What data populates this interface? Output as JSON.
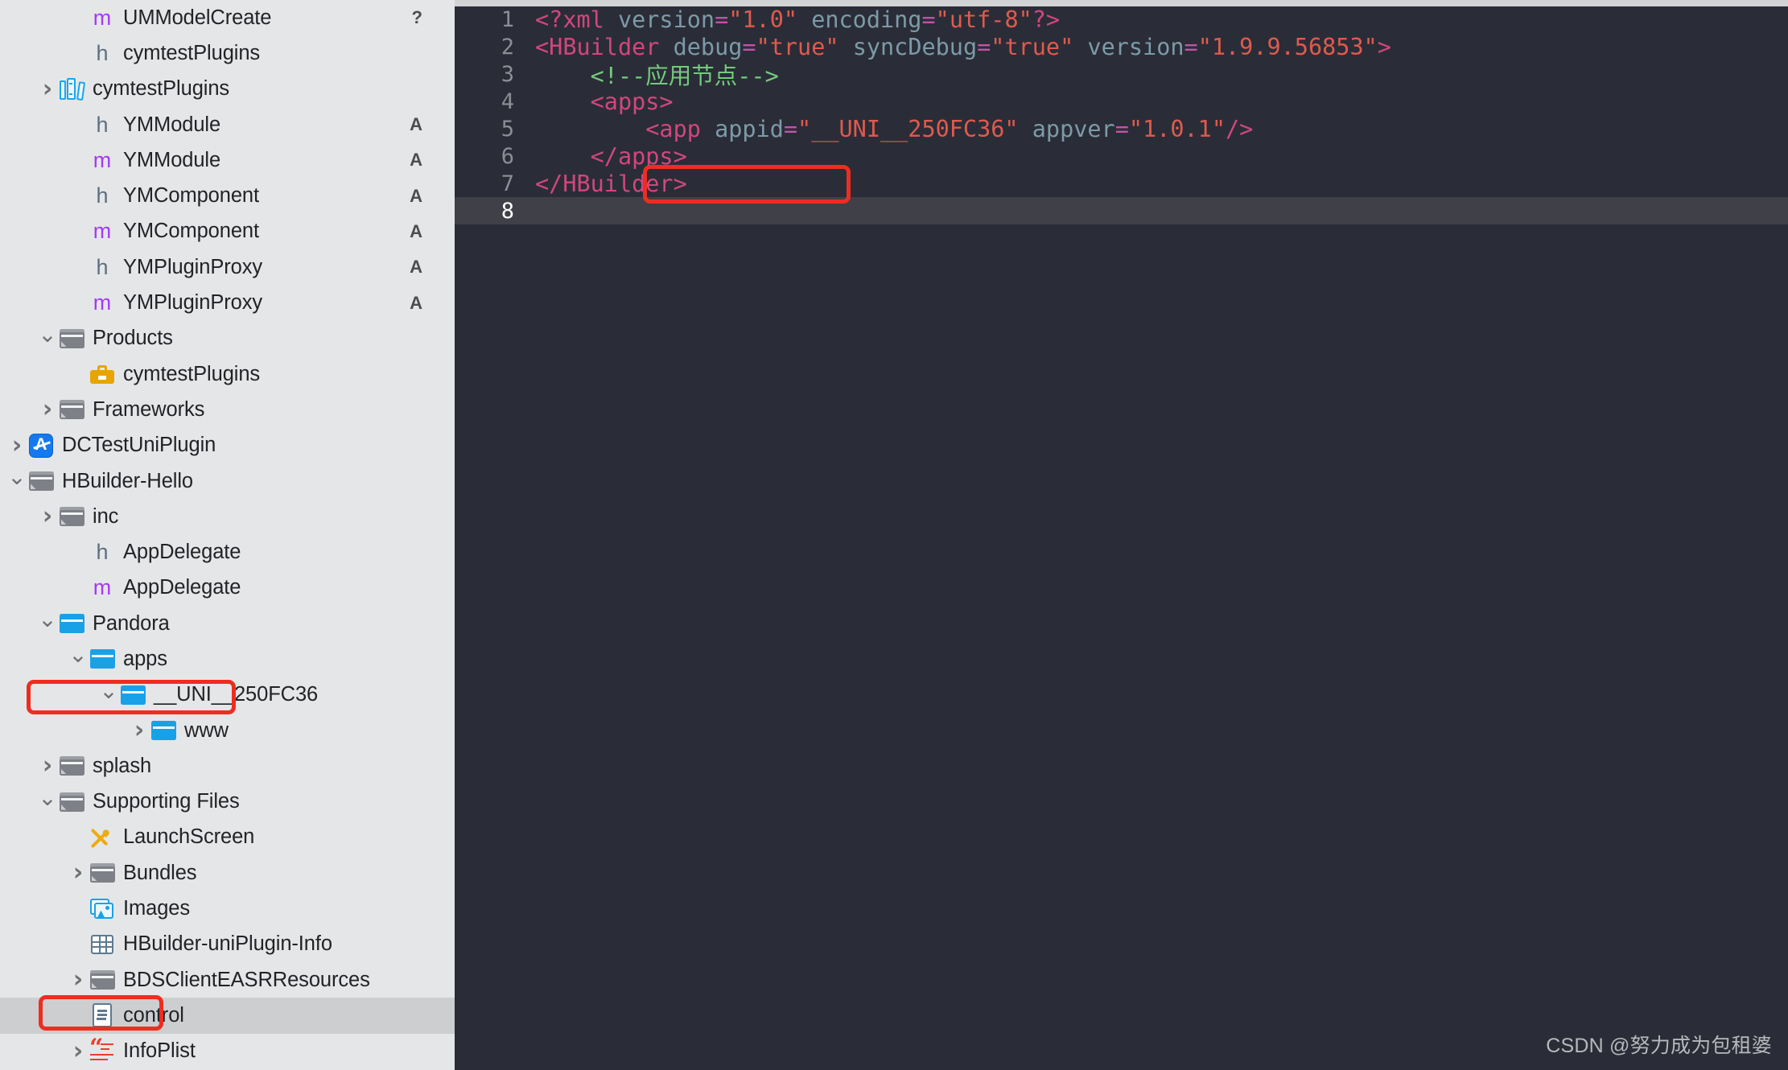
{
  "sidebar": {
    "name": "xcode-project-navigator",
    "selected_row": "control",
    "items": [
      {
        "label": "UMModelCreate",
        "icon": "m-file-icon",
        "indent": 2,
        "twisty": "none",
        "status": "?"
      },
      {
        "label": "cymtestPlugins",
        "icon": "h-file-icon",
        "indent": 2,
        "twisty": "none",
        "status": ""
      },
      {
        "label": "cymtestPlugins",
        "icon": "library-icon",
        "indent": 1,
        "twisty": "closed",
        "status": ""
      },
      {
        "label": "YMModule",
        "icon": "h-file-icon",
        "indent": 2,
        "twisty": "none",
        "status": "A"
      },
      {
        "label": "YMModule",
        "icon": "m-file-icon",
        "indent": 2,
        "twisty": "none",
        "status": "A"
      },
      {
        "label": "YMComponent",
        "icon": "h-file-icon",
        "indent": 2,
        "twisty": "none",
        "status": "A"
      },
      {
        "label": "YMComponent",
        "icon": "m-file-icon",
        "indent": 2,
        "twisty": "none",
        "status": "A"
      },
      {
        "label": "YMPluginProxy",
        "icon": "h-file-icon",
        "indent": 2,
        "twisty": "none",
        "status": "A"
      },
      {
        "label": "YMPluginProxy",
        "icon": "m-file-icon",
        "indent": 2,
        "twisty": "none",
        "status": "A"
      },
      {
        "label": "Products",
        "icon": "folder-gray-icon",
        "indent": 1,
        "twisty": "open",
        "status": ""
      },
      {
        "label": "cymtestPlugins",
        "icon": "toolbox-icon",
        "indent": 2,
        "twisty": "none",
        "status": ""
      },
      {
        "label": "Frameworks",
        "icon": "folder-gray-icon",
        "indent": 1,
        "twisty": "closed",
        "status": ""
      },
      {
        "label": "DCTestUniPlugin",
        "icon": "app-icon",
        "indent": 0,
        "twisty": "closed",
        "status": ""
      },
      {
        "label": "HBuilder-Hello",
        "icon": "folder-gray-icon",
        "indent": 0,
        "twisty": "open",
        "status": ""
      },
      {
        "label": "inc",
        "icon": "folder-gray-icon",
        "indent": 1,
        "twisty": "closed",
        "status": ""
      },
      {
        "label": "AppDelegate",
        "icon": "h-file-icon",
        "indent": 2,
        "twisty": "none",
        "status": ""
      },
      {
        "label": "AppDelegate",
        "icon": "m-file-icon",
        "indent": 2,
        "twisty": "none",
        "status": ""
      },
      {
        "label": "Pandora",
        "icon": "folder-blue-icon",
        "indent": 1,
        "twisty": "open",
        "status": ""
      },
      {
        "label": "apps",
        "icon": "folder-blue-icon",
        "indent": 2,
        "twisty": "open",
        "status": ""
      },
      {
        "label": "__UNI__250FC36",
        "icon": "folder-blue-icon",
        "indent": 3,
        "twisty": "open",
        "status": ""
      },
      {
        "label": "www",
        "icon": "folder-blue-icon",
        "indent": 4,
        "twisty": "closed",
        "status": ""
      },
      {
        "label": "splash",
        "icon": "folder-gray-icon",
        "indent": 1,
        "twisty": "closed",
        "status": ""
      },
      {
        "label": "Supporting Files",
        "icon": "folder-gray-icon",
        "indent": 1,
        "twisty": "open",
        "status": ""
      },
      {
        "label": "LaunchScreen",
        "icon": "xib-icon",
        "indent": 2,
        "twisty": "none",
        "status": ""
      },
      {
        "label": "Bundles",
        "icon": "folder-gray-icon",
        "indent": 2,
        "twisty": "closed",
        "status": ""
      },
      {
        "label": "Images",
        "icon": "asset-catalog-icon",
        "indent": 2,
        "twisty": "none",
        "status": ""
      },
      {
        "label": "HBuilder-uniPlugin-Info",
        "icon": "plist-grid-icon",
        "indent": 2,
        "twisty": "none",
        "status": ""
      },
      {
        "label": "BDSClientEASRResources",
        "icon": "folder-gray-icon",
        "indent": 2,
        "twisty": "closed",
        "status": ""
      },
      {
        "label": "control",
        "icon": "document-icon",
        "indent": 2,
        "twisty": "none",
        "status": ""
      },
      {
        "label": "InfoPlist",
        "icon": "strings-icon",
        "indent": 2,
        "twisty": "closed",
        "status": ""
      }
    ]
  },
  "annotations": {
    "highlight_color": "#ee2d20",
    "boxes": [
      {
        "name": "uni-folder-highlight",
        "target": "__UNI__250FC36 sidebar row"
      },
      {
        "name": "control-file-highlight",
        "target": "control sidebar row"
      },
      {
        "name": "appid-value-highlight",
        "target": "\"__UNI__250FC36\" in code"
      }
    ]
  },
  "editor": {
    "name": "xml-source-editor",
    "active_line": 8,
    "language": "xml",
    "lines": [
      {
        "number": "1",
        "tokens": [
          {
            "t": "<?xml ",
            "c": "tag"
          },
          {
            "t": "version",
            "c": "attr"
          },
          {
            "t": "=",
            "c": "eq"
          },
          {
            "t": "\"1.0\"",
            "c": "str"
          },
          {
            "t": " ",
            "c": "attr"
          },
          {
            "t": "encoding",
            "c": "attr"
          },
          {
            "t": "=",
            "c": "eq"
          },
          {
            "t": "\"utf-8\"",
            "c": "str"
          },
          {
            "t": "?>",
            "c": "tag"
          }
        ]
      },
      {
        "number": "2",
        "tokens": [
          {
            "t": "<HBuilder ",
            "c": "tag"
          },
          {
            "t": "debug",
            "c": "attr"
          },
          {
            "t": "=",
            "c": "eq"
          },
          {
            "t": "\"true\"",
            "c": "str"
          },
          {
            "t": " ",
            "c": "attr"
          },
          {
            "t": "syncDebug",
            "c": "attr"
          },
          {
            "t": "=",
            "c": "eq"
          },
          {
            "t": "\"true\"",
            "c": "str"
          },
          {
            "t": " ",
            "c": "attr"
          },
          {
            "t": "version",
            "c": "attr"
          },
          {
            "t": "=",
            "c": "eq"
          },
          {
            "t": "\"1.9.9.56853\"",
            "c": "str"
          },
          {
            "t": ">",
            "c": "tag"
          }
        ]
      },
      {
        "number": "3",
        "tokens": [
          {
            "t": "    <!--应用节点-->",
            "c": "cmt"
          }
        ]
      },
      {
        "number": "4",
        "tokens": [
          {
            "t": "    <apps>",
            "c": "tag"
          }
        ]
      },
      {
        "number": "5",
        "tokens": [
          {
            "t": "        <app ",
            "c": "tag"
          },
          {
            "t": "appid",
            "c": "attr"
          },
          {
            "t": "=",
            "c": "eq"
          },
          {
            "t": "\"__UNI__250FC36\"",
            "c": "str"
          },
          {
            "t": " ",
            "c": "attr"
          },
          {
            "t": "appver",
            "c": "attr"
          },
          {
            "t": "=",
            "c": "eq"
          },
          {
            "t": "\"1.0.1\"",
            "c": "str"
          },
          {
            "t": "/>",
            "c": "tag"
          }
        ]
      },
      {
        "number": "6",
        "tokens": [
          {
            "t": "    </apps>",
            "c": "tag"
          }
        ]
      },
      {
        "number": "7",
        "tokens": [
          {
            "t": "</HBuilder>",
            "c": "tag"
          }
        ]
      },
      {
        "number": "8",
        "tokens": []
      }
    ]
  },
  "watermark": {
    "text": "CSDN @努力成为包租婆"
  }
}
